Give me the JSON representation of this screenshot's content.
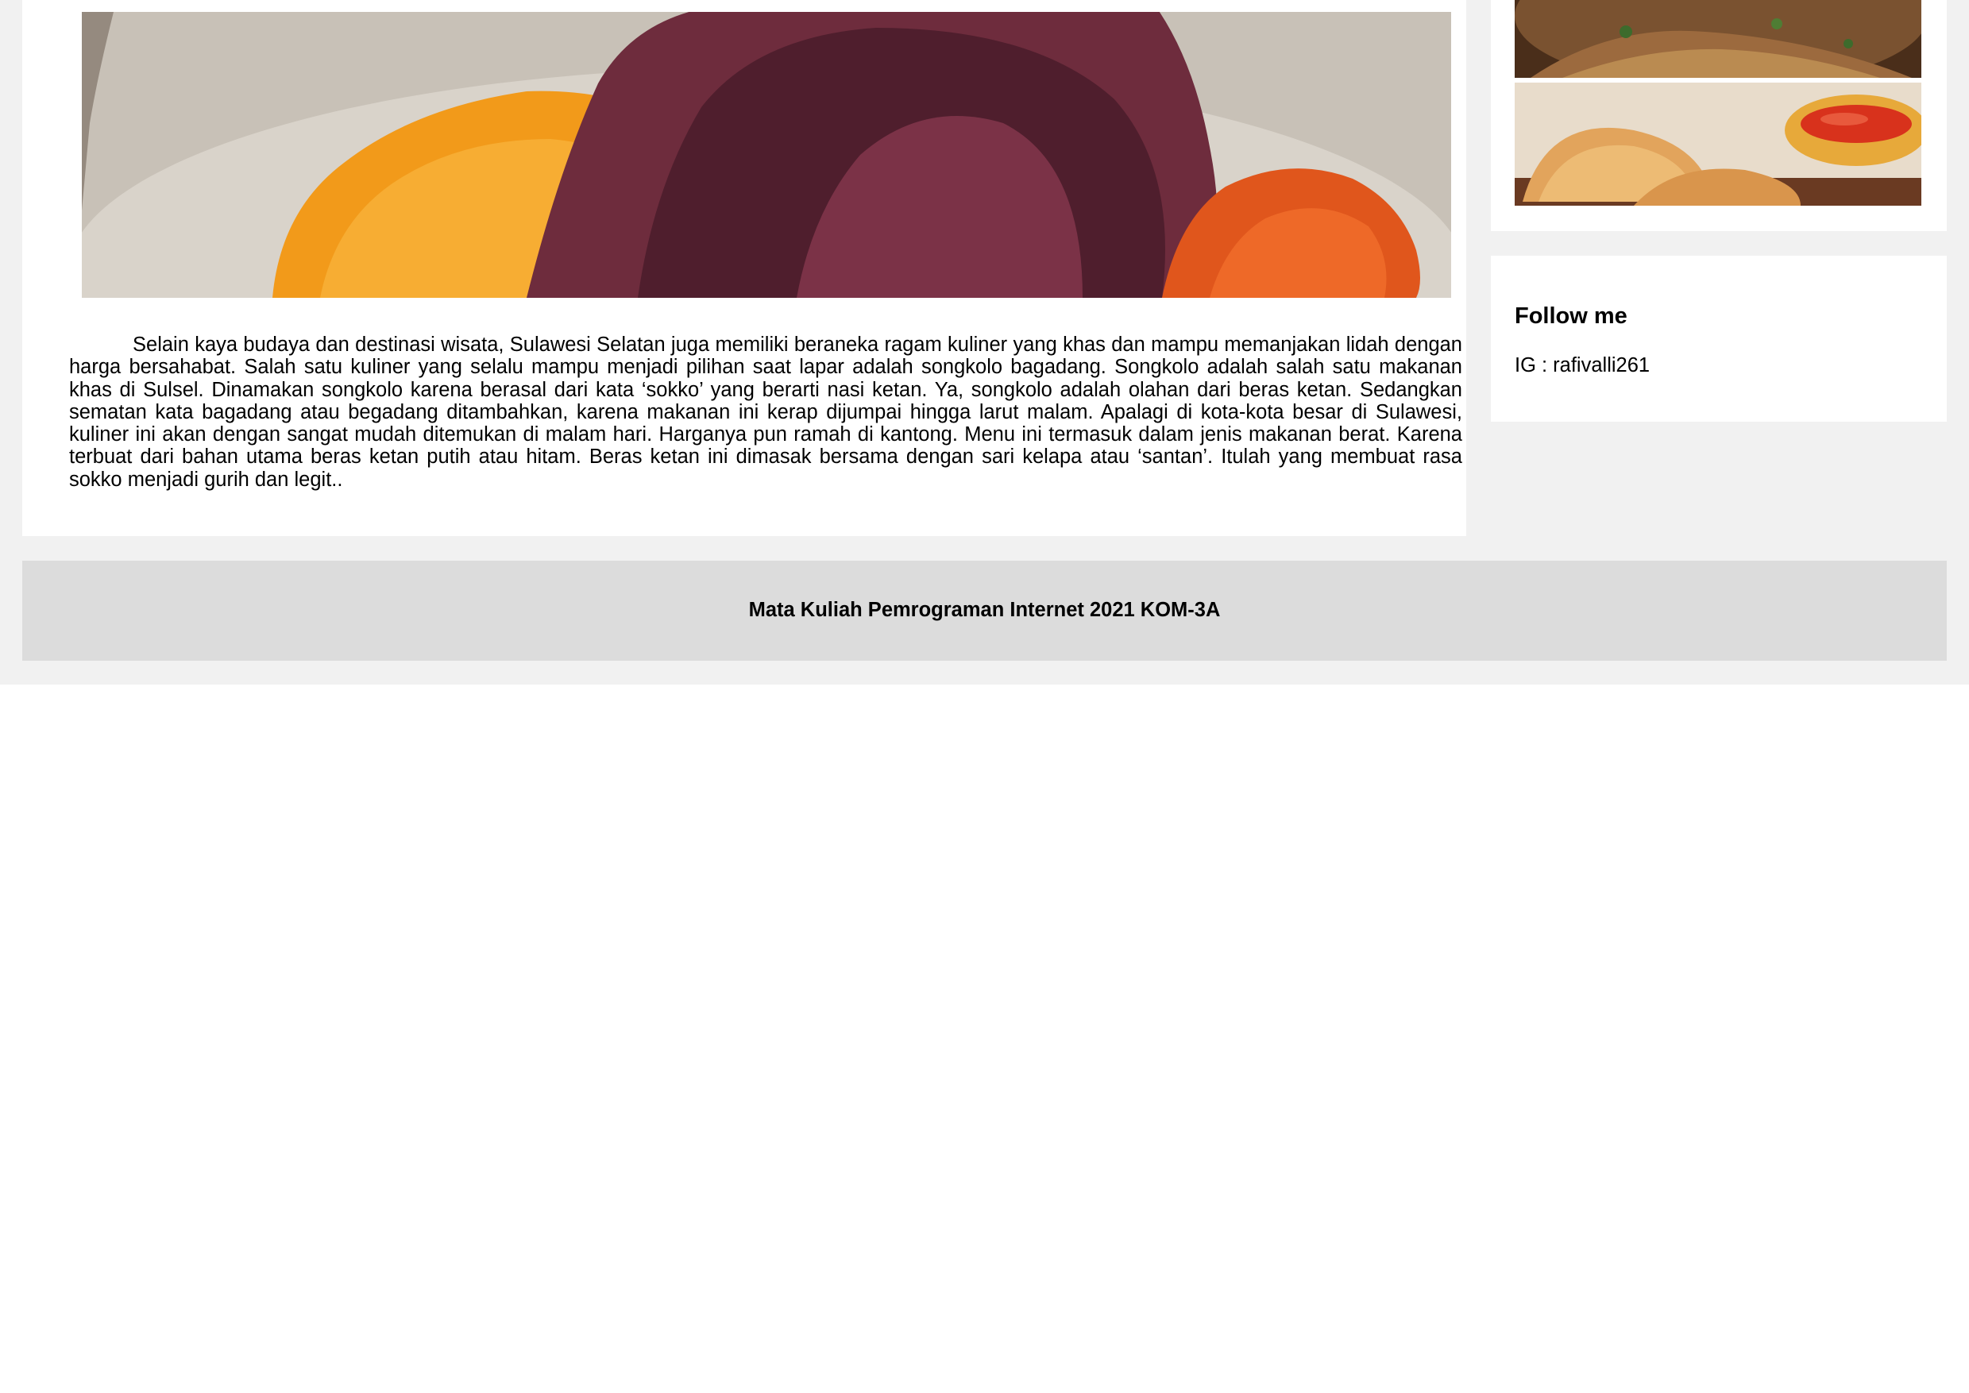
{
  "article": {
    "hero_image": "songkolo-bagadang-photo",
    "paragraph": "Selain kaya budaya dan destinasi wisata, Sulawesi Selatan juga memiliki beraneka ragam kuliner yang khas dan mampu memanjakan lidah dengan harga bersahabat. Salah satu kuliner yang selalu mampu menjadi pilihan saat lapar adalah songkolo bagadang. Songkolo adalah salah satu makanan khas di Sulsel. Dinamakan songkolo karena berasal dari kata ‘sokko’ yang berarti nasi ketan. Ya, songkolo adalah olahan dari beras ketan. Sedangkan sematan kata bagadang atau begadang ditambahkan, karena makanan ini kerap dijumpai hingga larut malam. Apalagi di kota-kota besar di Sulawesi, kuliner ini akan dengan sangat mudah ditemukan di malam hari. Harganya pun ramah di kantong. Menu ini termasuk dalam jenis makanan berat. Karena terbuat dari bahan utama beras ketan putih atau hitam. Beras ketan ini dimasak bersama dengan sari kelapa atau ‘santan’. Itulah yang membuat rasa sokko menjadi gurih dan legit.."
  },
  "sidebar": {
    "thumbnails": [
      "noodle-dish-photo",
      "pastel-dumpling-photo"
    ],
    "follow": {
      "title": "Follow me",
      "ig": "IG : rafivalli261"
    }
  },
  "footer": {
    "text": "Mata Kuliah Pemrograman Internet 2021 KOM-3A"
  },
  "colors": {
    "page_background": "#f1f1f1",
    "card_background": "#ffffff",
    "footer_background": "#dcdcdc"
  }
}
